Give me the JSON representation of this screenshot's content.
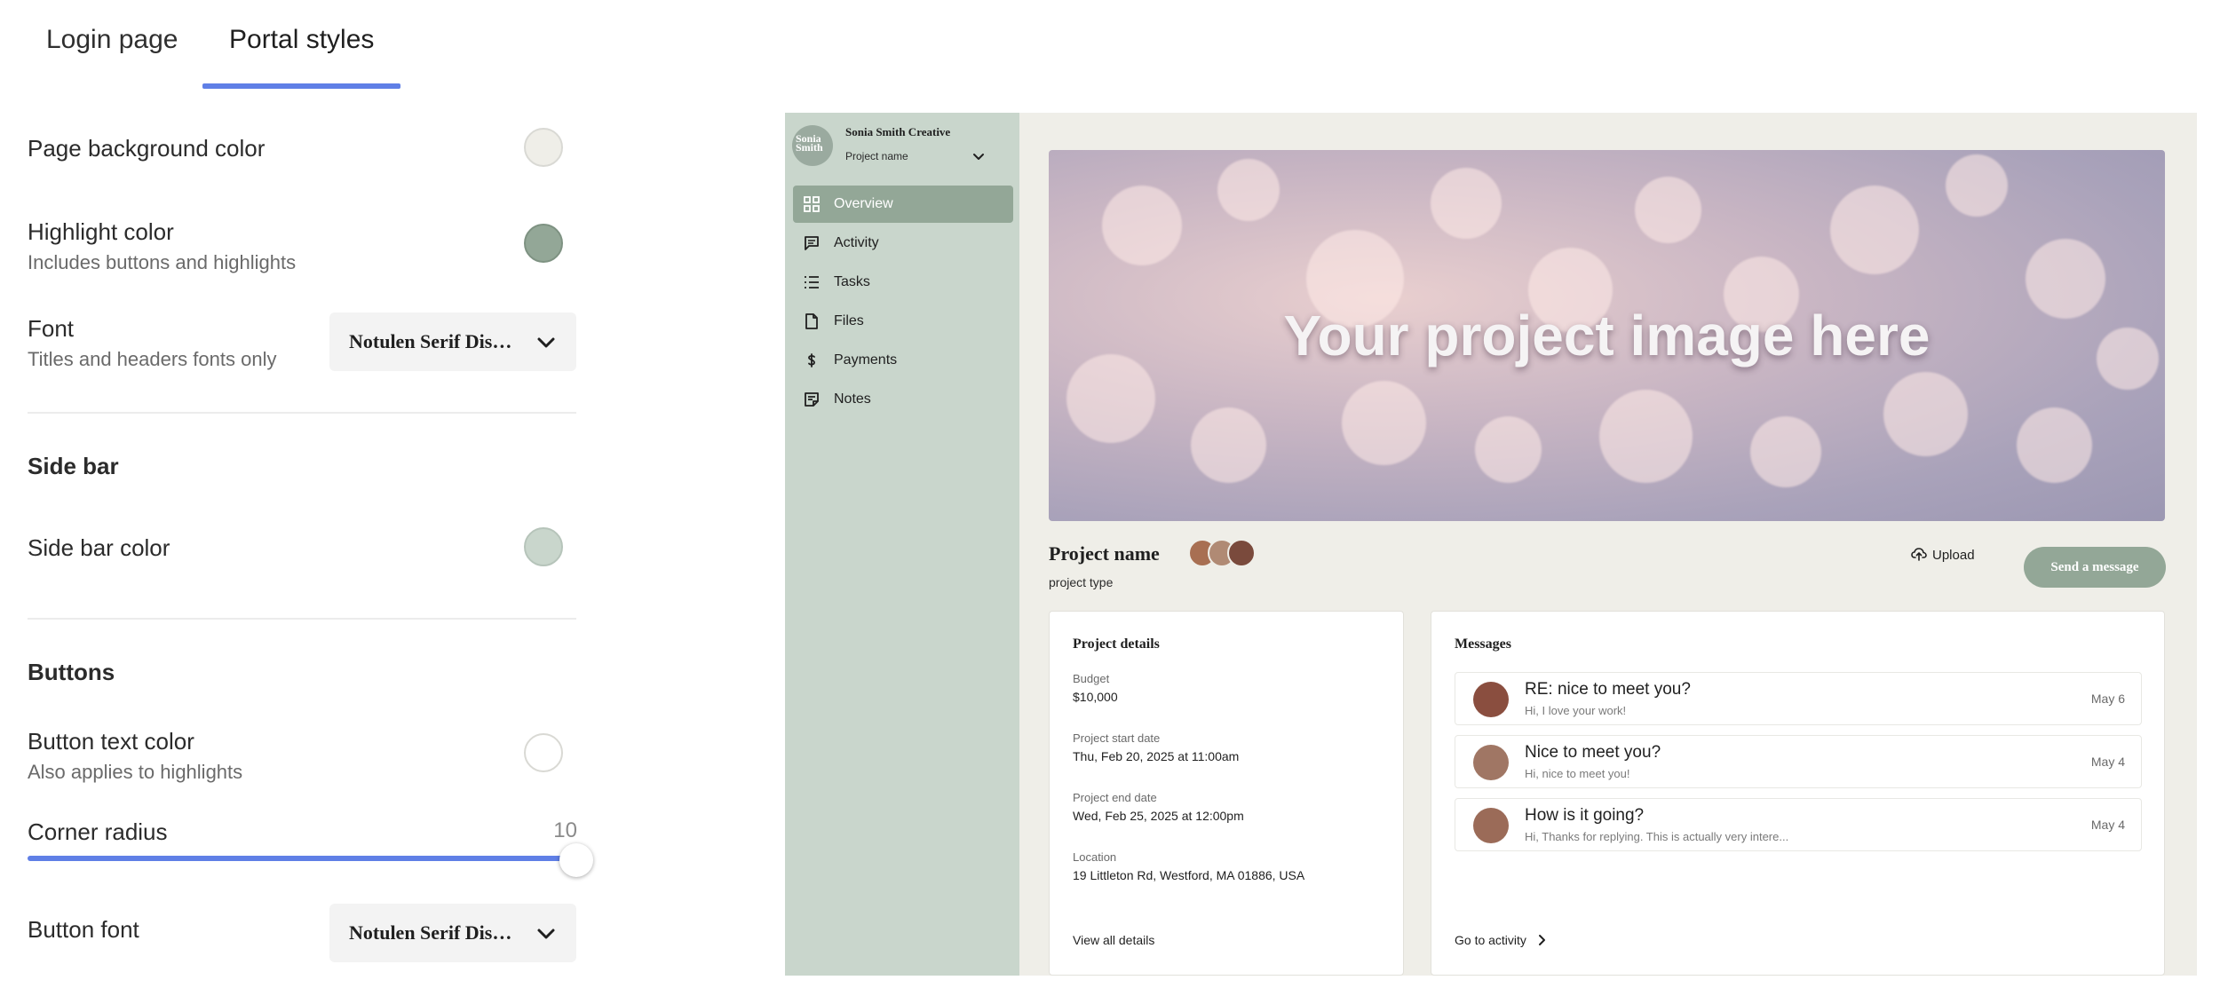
{
  "tabs": [
    {
      "label": "Login page",
      "active": false
    },
    {
      "label": "Portal styles",
      "active": true
    }
  ],
  "settings": {
    "page_background": {
      "label": "Page background color",
      "color": "#efeee8"
    },
    "highlight": {
      "label": "Highlight color",
      "sub": "Includes buttons and highlights",
      "color": "#93a797"
    },
    "font": {
      "label": "Font",
      "sub": "Titles and headers fonts only",
      "value": "Notulen Serif Display"
    },
    "sidebar_section": "Side bar",
    "sidebar_color": {
      "label": "Side bar color",
      "color": "#c9d6cc"
    },
    "buttons_section": "Buttons",
    "button_text_color": {
      "label": "Button text color",
      "sub": "Also applies to highlights",
      "color": "#ffffff"
    },
    "corner_radius": {
      "label": "Corner radius",
      "value": "10",
      "fraction": 1.0
    },
    "button_font": {
      "label": "Button font",
      "value": "Notulen Serif Display"
    }
  },
  "colors": {
    "accent": "#5f7fe6"
  },
  "portal": {
    "brand": "Sonia Smith Creative",
    "logo_text": "Sonia Smith",
    "project_selector": "Project name",
    "nav": [
      {
        "label": "Overview",
        "icon": "grid-icon",
        "active": true
      },
      {
        "label": "Activity",
        "icon": "chat-icon",
        "active": false
      },
      {
        "label": "Tasks",
        "icon": "list-icon",
        "active": false
      },
      {
        "label": "Files",
        "icon": "file-icon",
        "active": false
      },
      {
        "label": "Payments",
        "icon": "dollar-icon",
        "active": false
      },
      {
        "label": "Notes",
        "icon": "note-icon",
        "active": false
      }
    ],
    "hero_text": "Your project image here",
    "project_title": "Project name",
    "project_type": "project type",
    "upload_label": "Upload",
    "send_label": "Send a message",
    "details": {
      "title": "Project details",
      "budget_label": "Budget",
      "budget": "$10,000",
      "start_label": "Project start date",
      "start": "Thu, Feb 20, 2025 at 11:00am",
      "end_label": "Project end date",
      "end": "Wed, Feb 25, 2025 at 12:00pm",
      "location_label": "Location",
      "location": "19 Littleton Rd, Westford, MA 01886, USA",
      "view_all": "View all details"
    },
    "messages": {
      "title": "Messages",
      "items": [
        {
          "subject": "RE: nice to meet you?",
          "preview": "Hi, I love your work!",
          "date": "May 6"
        },
        {
          "subject": "Nice to meet you?",
          "preview": "Hi, nice to meet you!",
          "date": "May 4"
        },
        {
          "subject": "How is it going?",
          "preview": "Hi, Thanks for replying. This is actually very intere...",
          "date": "May 4"
        }
      ],
      "go_to_activity": "Go to activity"
    }
  }
}
